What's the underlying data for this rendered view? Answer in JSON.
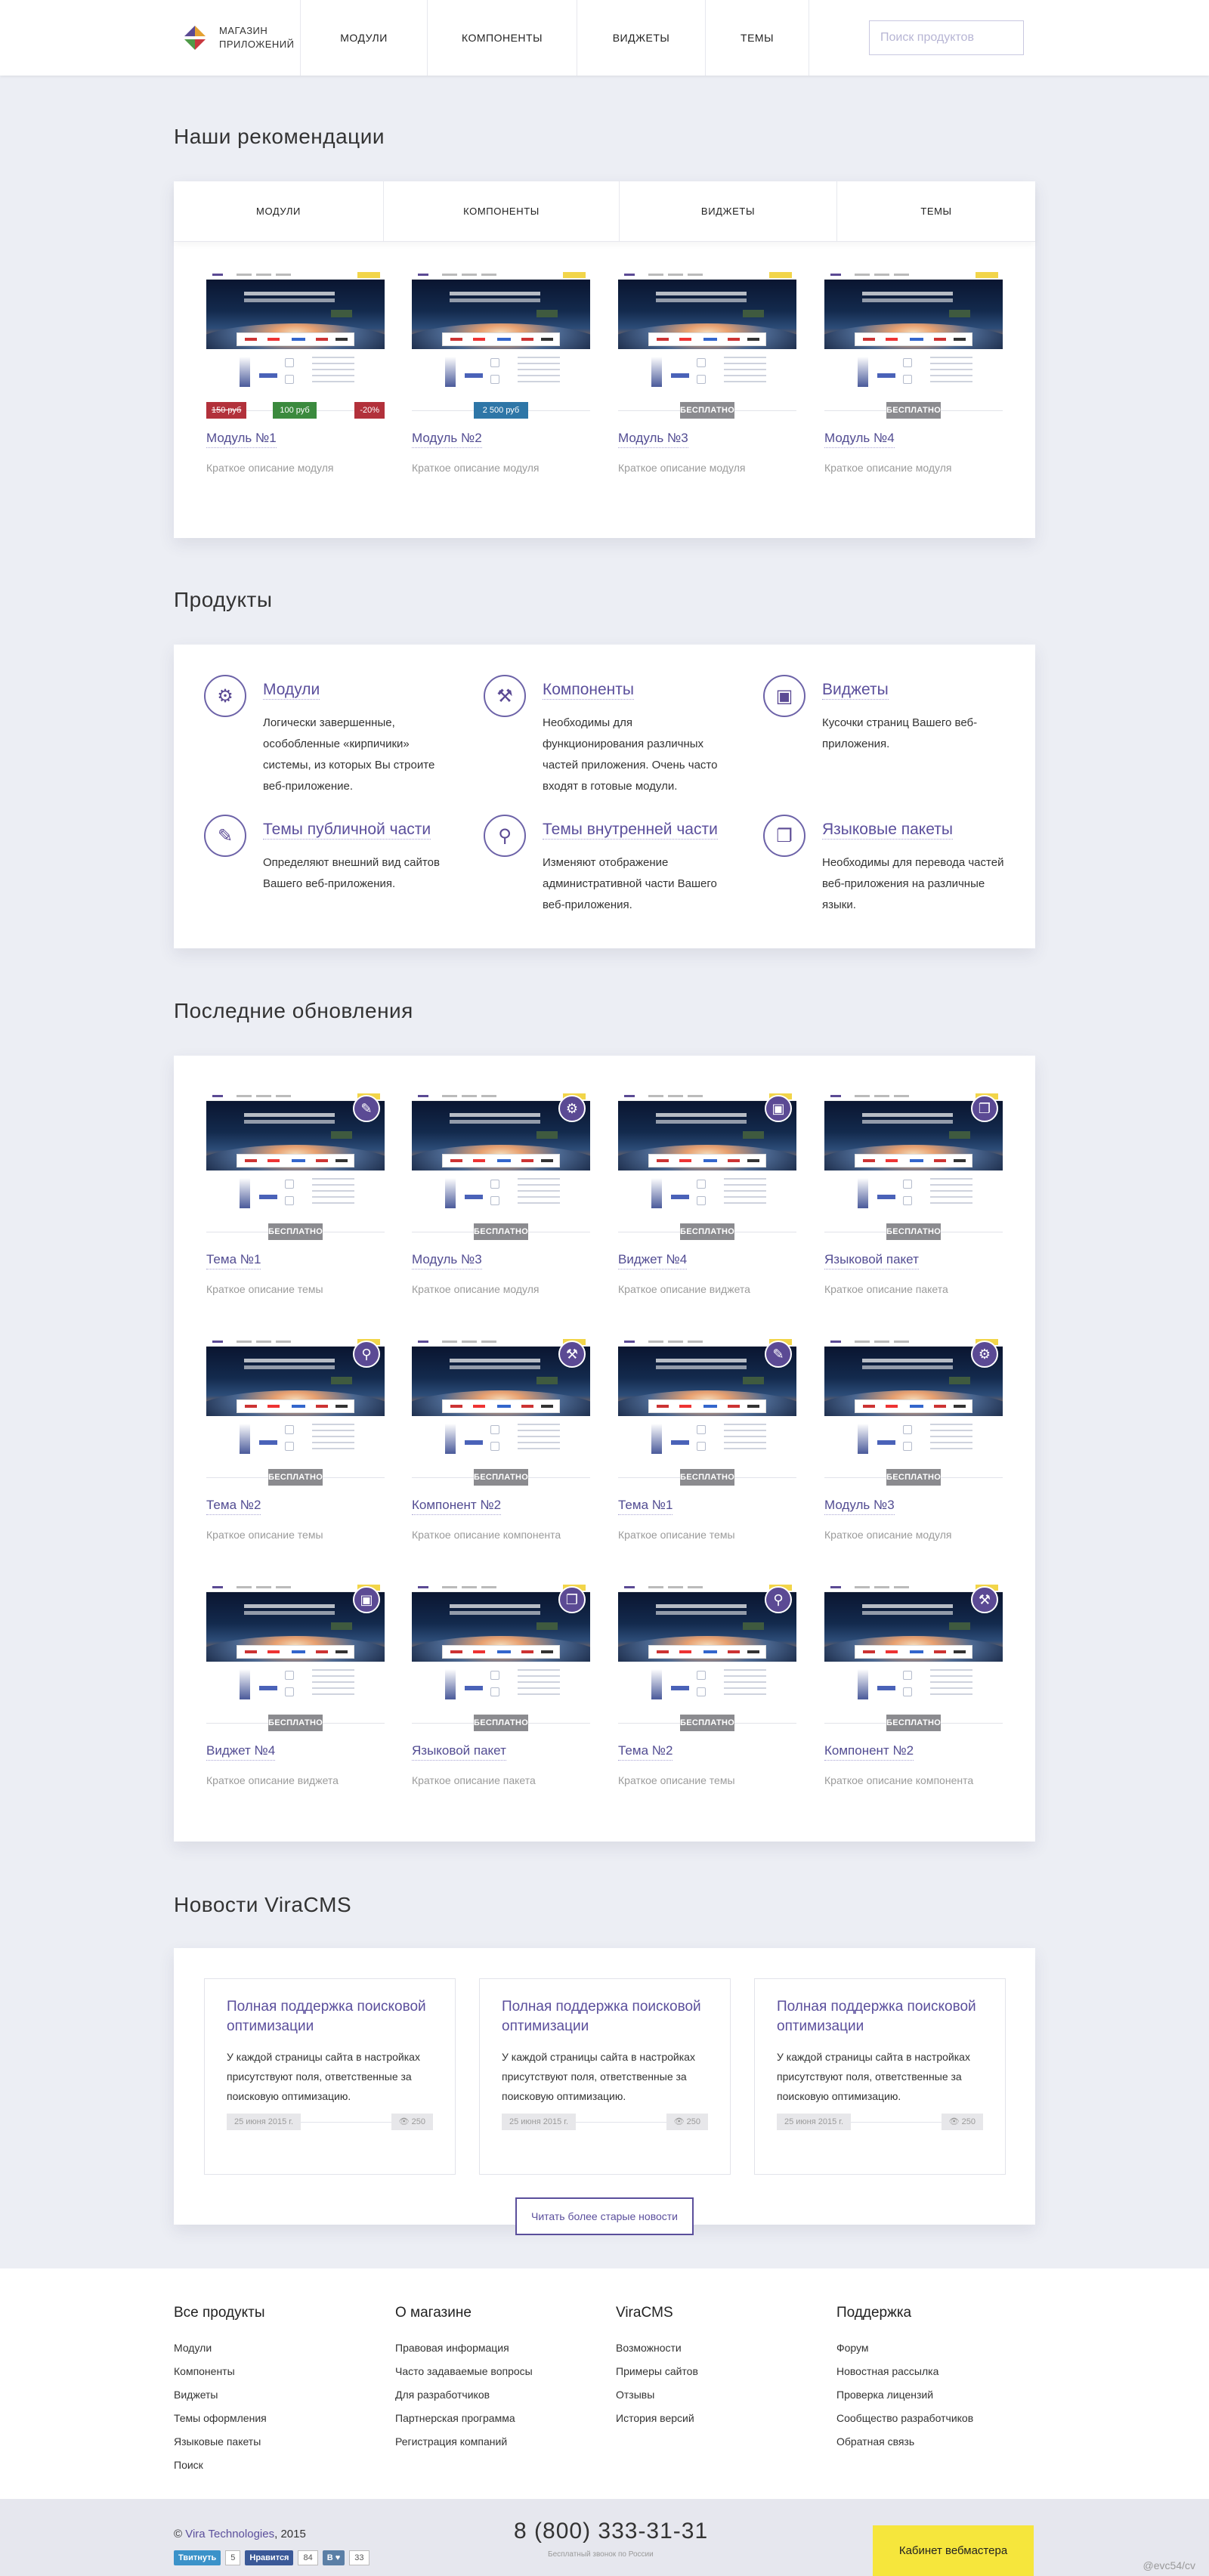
{
  "header": {
    "logo_line1": "МАГАЗИН",
    "logo_line2": "ПРИЛОЖЕНИЙ",
    "nav": [
      "МОДУЛИ",
      "КОМПОНЕНТЫ",
      "ВИДЖЕТЫ",
      "ТЕМЫ"
    ],
    "search_placeholder": "Поиск продуктов"
  },
  "recommendations": {
    "title": "Наши рекомендации",
    "tabs": [
      "МОДУЛИ",
      "КОМПОНЕНТЫ",
      "ВИДЖЕТЫ",
      "ТЕМЫ"
    ],
    "items": [
      {
        "name": "Модуль №1",
        "desc": "Краткое описание модуля",
        "old_price": "150 руб",
        "price": "100 руб",
        "discount": "-20%"
      },
      {
        "name": "Модуль №2",
        "desc": "Краткое описание модуля",
        "price": "2 500 руб"
      },
      {
        "name": "Модуль №3",
        "desc": "Краткое описание модуля",
        "badge": "БЕСПЛАТНО"
      },
      {
        "name": "Модуль №4",
        "desc": "Краткое описание модуля",
        "badge": "БЕСПЛАТНО"
      }
    ]
  },
  "products": {
    "title": "Продукты",
    "items": [
      {
        "icon": "modules-icon",
        "name": "Модули",
        "desc": "Логически завершенные, особобленные «кирпичики» системы, из которых Вы строите веб-приложение."
      },
      {
        "icon": "components-icon",
        "name": "Компоненты",
        "desc": "Необходимы для функционирования различных частей приложения. Очень часто входят в готовые модули."
      },
      {
        "icon": "widgets-icon",
        "name": "Виджеты",
        "desc": "Кусочки страниц Вашего веб-приложения."
      },
      {
        "icon": "brush-icon",
        "name": "Темы публичной части",
        "desc": "Определяют внешний вид сайтов Вашего веб-приложения."
      },
      {
        "icon": "hierarchy-icon",
        "name": "Темы внутренней части",
        "desc": "Изменяют отображение административной части Вашего веб-приложения."
      },
      {
        "icon": "language-icon",
        "name": "Языковые пакеты",
        "desc": "Необходимы для перевода частей веб-приложения на различные языки."
      }
    ]
  },
  "updates": {
    "title": "Последние обновления",
    "badge": "БЕСПЛАТНО",
    "items": [
      {
        "name": "Тема №1",
        "desc": "Краткое описание темы",
        "icon": "brush-icon"
      },
      {
        "name": "Модуль №3",
        "desc": "Краткое описание модуля",
        "icon": "modules-icon"
      },
      {
        "name": "Виджет №4",
        "desc": "Краткое описание виджета",
        "icon": "widgets-icon"
      },
      {
        "name": "Языковой пакет",
        "desc": "Краткое описание пакета",
        "icon": "language-icon"
      },
      {
        "name": "Тема №2",
        "desc": "Краткое описание темы",
        "icon": "hierarchy-icon"
      },
      {
        "name": "Компонент №2",
        "desc": "Краткое описание компонента",
        "icon": "components-icon"
      },
      {
        "name": "Тема №1",
        "desc": "Краткое описание темы",
        "icon": "brush-icon"
      },
      {
        "name": "Модуль №3",
        "desc": "Краткое описание модуля",
        "icon": "modules-icon"
      },
      {
        "name": "Виджет №4",
        "desc": "Краткое описание виджета",
        "icon": "widgets-icon"
      },
      {
        "name": "Языковой пакет",
        "desc": "Краткое описание пакета",
        "icon": "language-icon"
      },
      {
        "name": "Тема №2",
        "desc": "Краткое описание темы",
        "icon": "hierarchy-icon"
      },
      {
        "name": "Компонент №2",
        "desc": "Краткое описание компонента",
        "icon": "components-icon"
      }
    ]
  },
  "news": {
    "title": "Новости ViraCMS",
    "items": [
      {
        "title": "Полная поддержка поисковой оптимизации",
        "text": "У каждой страницы сайта в настройках присутствуют поля, ответственные за поисковую оптимизацию.",
        "date": "25 июня 2015 г.",
        "views": "250"
      },
      {
        "title": "Полная поддержка поисковой оптимизации",
        "text": "У каждой страницы сайта в настройках присутствуют поля, ответственные за поисковую оптимизацию.",
        "date": "25 июня 2015 г.",
        "views": "250"
      },
      {
        "title": "Полная поддержка поисковой оптимизации",
        "text": "У каждой страницы сайта в настройках присутствуют поля, ответственные за поисковую оптимизацию.",
        "date": "25 июня 2015 г.",
        "views": "250"
      }
    ],
    "older_label": "Читать более старые новости"
  },
  "footer": {
    "columns": [
      {
        "title": "Все продукты",
        "links": [
          "Модули",
          "Компоненты",
          "Виджеты",
          "Темы оформления",
          "Языковые пакеты",
          "Поиск"
        ]
      },
      {
        "title": "О магазине",
        "links": [
          "Правовая информация",
          "Часто задаваемые вопросы",
          "Для разработчиков",
          "Партнерская программа",
          "Регистрация компаний"
        ]
      },
      {
        "title": "ViraCMS",
        "links": [
          "Возможности",
          "Примеры сайтов",
          "Отзывы",
          "История версий"
        ]
      },
      {
        "title": "Поддержка",
        "links": [
          "Форум",
          "Новостная рассылка",
          "Проверка лицензий",
          "Сообщество разработчиков",
          "Обратная связь"
        ]
      }
    ],
    "copyright_prefix": "© ",
    "copyright_link": "Vira Technologies",
    "copyright_suffix": ", 2015",
    "twitter_label": "Твитнуть",
    "twitter_count": "5",
    "fb_label": "Нравится",
    "fb_count": "84",
    "vk_label": "В ♥",
    "vk_count": "33",
    "phone": "8 (800) 333-31-31",
    "phone_note": "Бесплатный звонок по России",
    "cabinet_label": "Кабинет вебмастера",
    "credit": "@evc54/cv"
  },
  "colors": {
    "accent": "#5b4f9c",
    "yellow": "#f6e63c",
    "free_badge": "#8b8b8f",
    "sale": "#b2313b",
    "price_green": "#3b8a3e",
    "price_blue": "#2e76a7"
  }
}
